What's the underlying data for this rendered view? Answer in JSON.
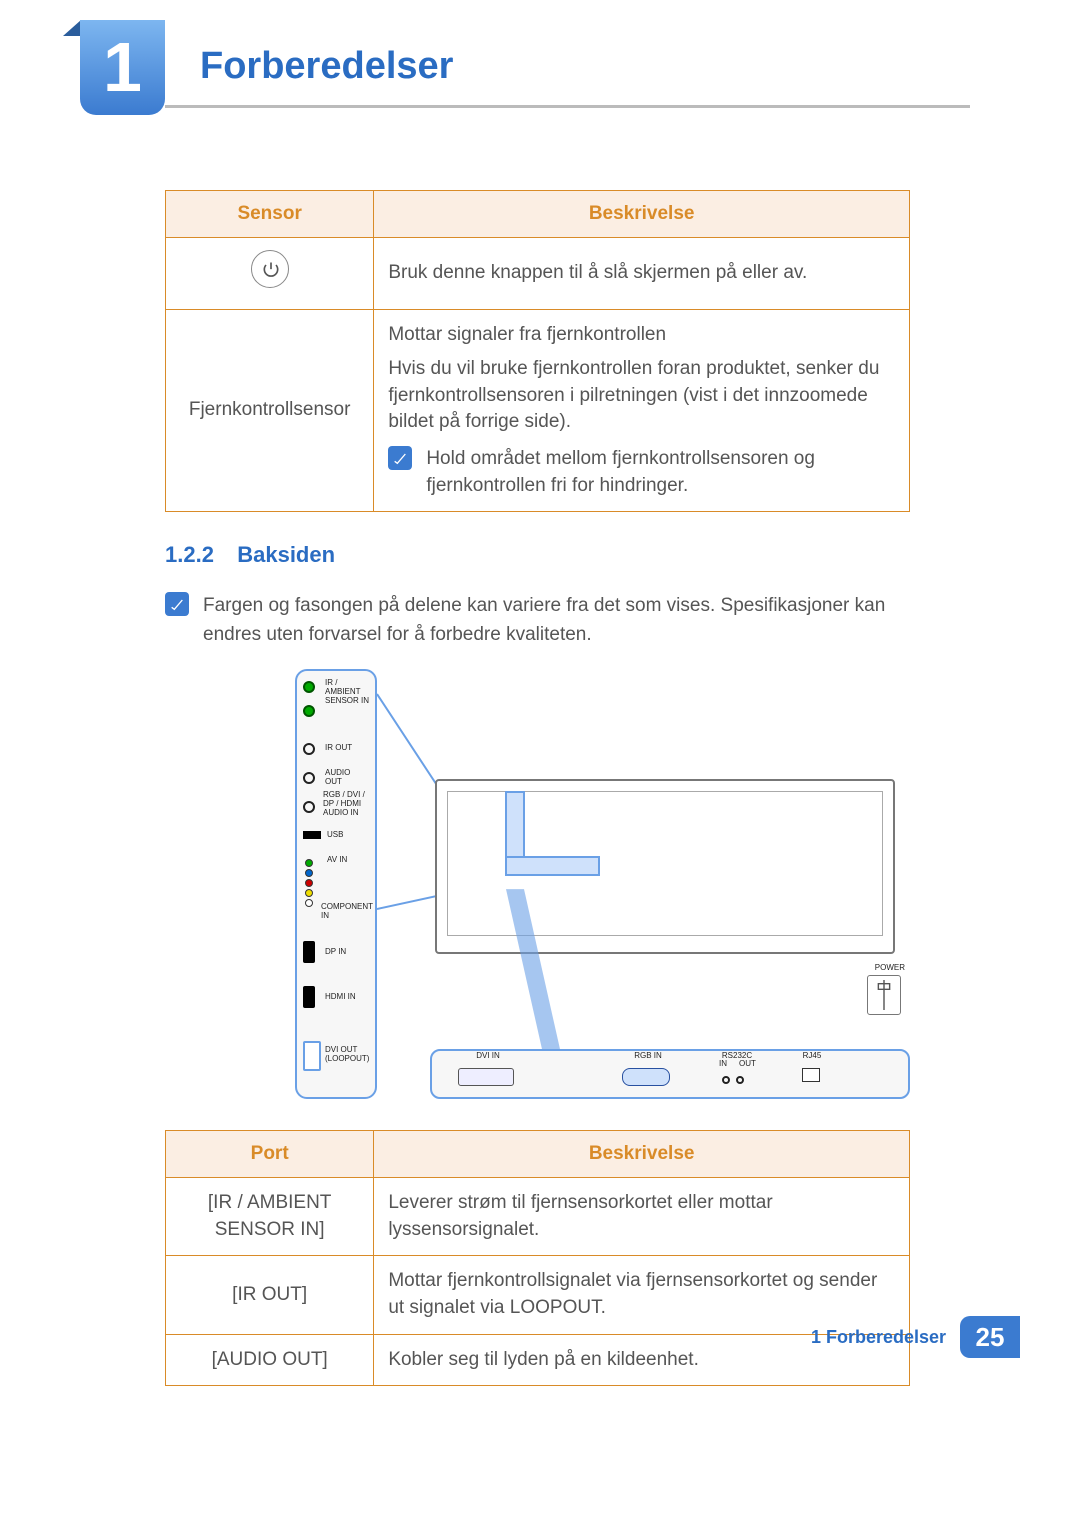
{
  "chapter": {
    "number": "1",
    "title": "Forberedelser"
  },
  "sensor_table": {
    "headers": {
      "sensor": "Sensor",
      "description": "Beskrivelse"
    },
    "rows": [
      {
        "sensor_icon": "power-icon",
        "description": "Bruk denne knappen til å slå skjermen på eller av."
      },
      {
        "sensor_label": "Fjernkontrollsensor",
        "description_line1": "Mottar signaler fra fjernkontrollen",
        "description_line2": "Hvis du vil bruke fjernkontrollen foran produktet, senker du fjernkontrollsensoren i pilretningen (vist i det innzoomede bildet på forrige side).",
        "note": "Hold området mellom fjernkontrollsensoren og fjernkontrollen fri for hindringer."
      }
    ]
  },
  "section": {
    "number": "1.2.2",
    "title": "Baksiden",
    "note": "Fargen og fasongen på delene kan variere fra det som vises. Spesifikasjoner kan endres uten forvarsel for å forbedre kvaliteten."
  },
  "port_panel_labels": {
    "ir_ambient": "IR /\nAMBIENT\nSENSOR IN",
    "ir_out": "IR OUT",
    "audio_out": "AUDIO\nOUT",
    "audio_in": "RGB / DVI /\nDP / HDMI\nAUDIO IN",
    "usb": "USB",
    "av_in": "AV IN",
    "component_in": "COMPONENT\nIN",
    "dp_in": "DP IN",
    "hdmi_in": "HDMI IN",
    "dvi_out": "DVI OUT\n(LOOPOUT)"
  },
  "bottom_labels": {
    "dvi_in": "DVI IN",
    "rgb_in": "RGB IN",
    "rs232c": "RS232C",
    "rs_in": "IN",
    "rs_out": "OUT",
    "rj45": "RJ45",
    "power": "POWER"
  },
  "port_table": {
    "headers": {
      "port": "Port",
      "description": "Beskrivelse"
    },
    "rows": [
      {
        "port": "[IR / AMBIENT SENSOR IN]",
        "description": "Leverer strøm til fjernsensorkortet eller mottar lyssensorsignalet."
      },
      {
        "port": "[IR OUT]",
        "description": "Mottar fjernkontrollsignalet via fjernsensorkortet og sender ut signalet via LOOPOUT."
      },
      {
        "port": "[AUDIO OUT]",
        "description": "Kobler seg til lyden på en kildeenhet."
      }
    ]
  },
  "footer": {
    "text": "1 Forberedelser",
    "page_number": "25"
  }
}
